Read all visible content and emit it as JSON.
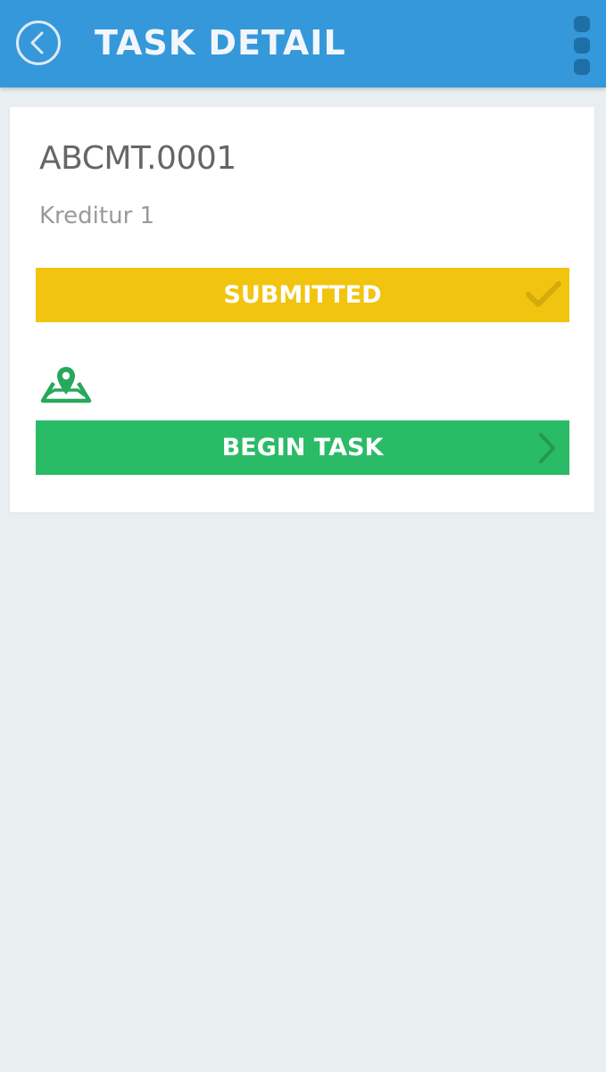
{
  "app_bar": {
    "title": "TASK DETAIL",
    "back_icon": "chevron-left-circle-icon",
    "menu_icon": "more-vertical-icon"
  },
  "task": {
    "id": "ABCMT.0001",
    "subtitle": "Kreditur 1",
    "status": {
      "label": "SUBMITTED",
      "icon": "check-icon",
      "color": "#f1c40f"
    },
    "location_icon": "map-pin-icon",
    "action": {
      "label": "BEGIN TASK",
      "icon": "chevron-right-icon",
      "color": "#2abb67"
    }
  },
  "colors": {
    "app_bar": "#3598db",
    "background": "#e9eef0",
    "card": "#ffffff",
    "title_text": "#666666",
    "subtitle_text": "#9a9a9a"
  }
}
